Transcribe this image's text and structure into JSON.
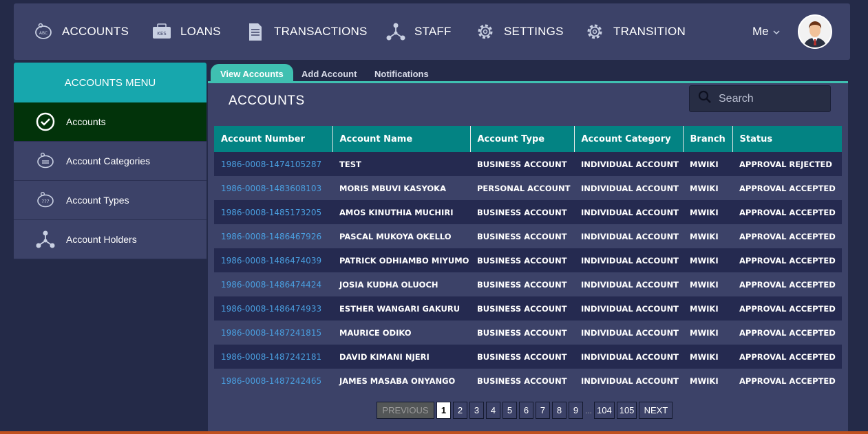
{
  "nav": {
    "items": [
      {
        "label": "ACCOUNTS",
        "icon": "piggy-bank-icon"
      },
      {
        "label": "LOANS",
        "icon": "money-icon"
      },
      {
        "label": "TRANSACTIONS",
        "icon": "document-icon"
      },
      {
        "label": "STAFF",
        "icon": "hierarchy-icon"
      },
      {
        "label": "SETTINGS",
        "icon": "gear-icon"
      },
      {
        "label": "TRANSITION",
        "icon": "gear-icon"
      }
    ],
    "me_label": "Me"
  },
  "sidebar": {
    "title": "ACCOUNTS MENU",
    "items": [
      {
        "label": "Accounts",
        "icon": "check-circle-icon"
      },
      {
        "label": "Account Categories",
        "icon": "piggy-bank-icon"
      },
      {
        "label": "Account Types",
        "icon": "piggy-bank-icon"
      },
      {
        "label": "Account Holders",
        "icon": "hierarchy-icon"
      }
    ]
  },
  "tabs": [
    "View Accounts",
    "Add Account",
    "Notifications"
  ],
  "main": {
    "title": "ACCOUNTS",
    "search_placeholder": "Search"
  },
  "table": {
    "headers": [
      "Account Number",
      "Account Name",
      "Account Type",
      "Account Category",
      "Branch",
      "Status"
    ],
    "rows": [
      [
        "1986-0008-1474105287",
        "TEST",
        "BUSINESS ACCOUNT",
        "INDIVIDUAL ACCOUNT",
        "MWIKI",
        "APPROVAL REJECTED"
      ],
      [
        "1986-0008-1483608103",
        "MORIS MBUVI KASYOKA",
        "PERSONAL ACCOUNT",
        "INDIVIDUAL ACCOUNT",
        "MWIKI",
        "APPROVAL ACCEPTED"
      ],
      [
        "1986-0008-1485173205",
        "AMOS KINUTHIA MUCHIRI",
        "BUSINESS ACCOUNT",
        "INDIVIDUAL ACCOUNT",
        "MWIKI",
        "APPROVAL ACCEPTED"
      ],
      [
        "1986-0008-1486467926",
        "PASCAL MUKOYA OKELLO",
        "BUSINESS ACCOUNT",
        "INDIVIDUAL ACCOUNT",
        "MWIKI",
        "APPROVAL ACCEPTED"
      ],
      [
        "1986-0008-1486474039",
        "PATRICK ODHIAMBO MIYUMO",
        "BUSINESS ACCOUNT",
        "INDIVIDUAL ACCOUNT",
        "MWIKI",
        "APPROVAL ACCEPTED"
      ],
      [
        "1986-0008-1486474424",
        "JOSIA KUDHA OLUOCH",
        "BUSINESS ACCOUNT",
        "INDIVIDUAL ACCOUNT",
        "MWIKI",
        "APPROVAL ACCEPTED"
      ],
      [
        "1986-0008-1486474933",
        "ESTHER WANGARI GAKURU",
        "BUSINESS ACCOUNT",
        "INDIVIDUAL ACCOUNT",
        "MWIKI",
        "APPROVAL ACCEPTED"
      ],
      [
        "1986-0008-1487241815",
        "MAURICE ODIKO",
        "BUSINESS ACCOUNT",
        "INDIVIDUAL ACCOUNT",
        "MWIKI",
        "APPROVAL ACCEPTED"
      ],
      [
        "1986-0008-1487242181",
        "DAVID KIMANI NJERI",
        "BUSINESS ACCOUNT",
        "INDIVIDUAL ACCOUNT",
        "MWIKI",
        "APPROVAL ACCEPTED"
      ],
      [
        "1986-0008-1487242465",
        "JAMES MASABA ONYANGO",
        "BUSINESS ACCOUNT",
        "INDIVIDUAL ACCOUNT",
        "MWIKI",
        "APPROVAL ACCEPTED"
      ]
    ]
  },
  "pagination": {
    "previous": "PREVIOUS",
    "pages": [
      "1",
      "2",
      "3",
      "4",
      "5",
      "6",
      "7",
      "8",
      "9"
    ],
    "ellipsis": "...",
    "last_pages": [
      "104",
      "105"
    ],
    "next": "NEXT",
    "current": "1"
  },
  "colors": {
    "accent_teal": "#17a7ad",
    "table_header": "#038383",
    "active_sidebar": "#02330a",
    "link_blue": "#4a9fe0"
  }
}
